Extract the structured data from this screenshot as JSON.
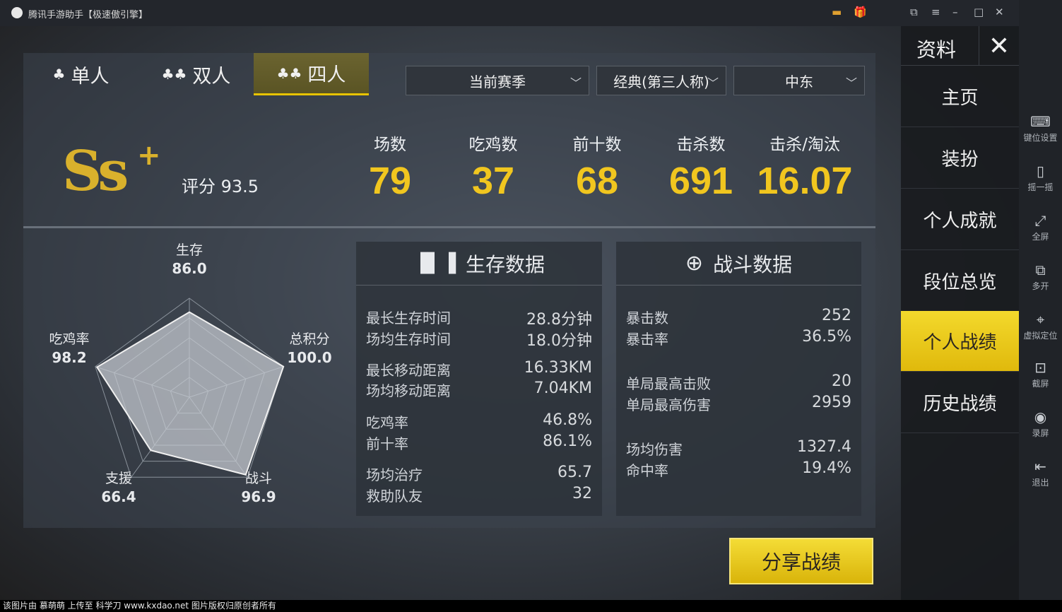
{
  "window": {
    "title": "腾讯手游助手【极速傲引擎】"
  },
  "modes": [
    {
      "label": "单人"
    },
    {
      "label": "双人"
    },
    {
      "label": "四人"
    }
  ],
  "filters": {
    "season": "当前赛季",
    "perspective": "经典(第三人称)",
    "region": "中东"
  },
  "rating": {
    "grade": "Ss",
    "plus": "+",
    "score_label": "评分 93.5"
  },
  "stats": [
    {
      "label": "场数",
      "value": "79"
    },
    {
      "label": "吃鸡数",
      "value": "37"
    },
    {
      "label": "前十数",
      "value": "68"
    },
    {
      "label": "击杀数",
      "value": "691"
    },
    {
      "label": "击杀/淘汰",
      "value": "16.07"
    }
  ],
  "radar": {
    "axes": [
      {
        "label": "生存",
        "value": "86.0",
        "score": 86.0
      },
      {
        "label": "总积分",
        "value": "100.0",
        "score": 100.0
      },
      {
        "label": "战斗",
        "value": "96.9",
        "score": 96.9
      },
      {
        "label": "支援",
        "value": "66.4",
        "score": 66.4
      },
      {
        "label": "吃鸡率",
        "value": "98.2",
        "score": 98.2
      }
    ]
  },
  "survival": {
    "title": "生存数据",
    "rows": [
      {
        "label": "最长生存时间",
        "value": "28.8分钟"
      },
      {
        "label": "场均生存时间",
        "value": "18.0分钟"
      },
      {
        "label": "最长移动距离",
        "value": "16.33KM"
      },
      {
        "label": "场均移动距离",
        "value": "7.04KM"
      },
      {
        "label": "吃鸡率",
        "value": "46.8%"
      },
      {
        "label": "前十率",
        "value": "86.1%"
      },
      {
        "label": "场均治疗",
        "value": "65.7"
      },
      {
        "label": "救助队友",
        "value": "32"
      }
    ]
  },
  "combat": {
    "title": "战斗数据",
    "rows": [
      {
        "label": "暴击数",
        "value": "252"
      },
      {
        "label": "暴击率",
        "value": "36.5%"
      },
      {
        "label": "单局最高击败",
        "value": "20"
      },
      {
        "label": "单局最高伤害",
        "value": "2959"
      },
      {
        "label": "场均伤害",
        "value": "1327.4"
      },
      {
        "label": "命中率",
        "value": "19.4%"
      }
    ]
  },
  "share_label": "分享战绩",
  "sidebar": {
    "title": "资料",
    "close": "✕",
    "items": [
      {
        "label": "主页"
      },
      {
        "label": "装扮"
      },
      {
        "label": "个人成就"
      },
      {
        "label": "段位总览"
      },
      {
        "label": "个人战绩"
      },
      {
        "label": "历史战绩"
      }
    ]
  },
  "tools": [
    {
      "label": "键位设置",
      "icon": "keyboard-icon"
    },
    {
      "label": "摇一摇",
      "icon": "shake-icon"
    },
    {
      "label": "全屏",
      "icon": "fullscreen-icon"
    },
    {
      "label": "多开",
      "icon": "multi-window-icon"
    },
    {
      "label": "虚拟定位",
      "icon": "location-icon"
    },
    {
      "label": "截屏",
      "icon": "screenshot-icon"
    },
    {
      "label": "录屏",
      "icon": "record-icon"
    },
    {
      "label": "退出",
      "icon": "exit-icon"
    }
  ],
  "footer": "该图片由 慕萌萌 上传至 科学刀 www.kxdao.net 图片版权归原创者所有",
  "colors": {
    "accent": "#f1c61f",
    "active_tab": "#e8c300"
  }
}
